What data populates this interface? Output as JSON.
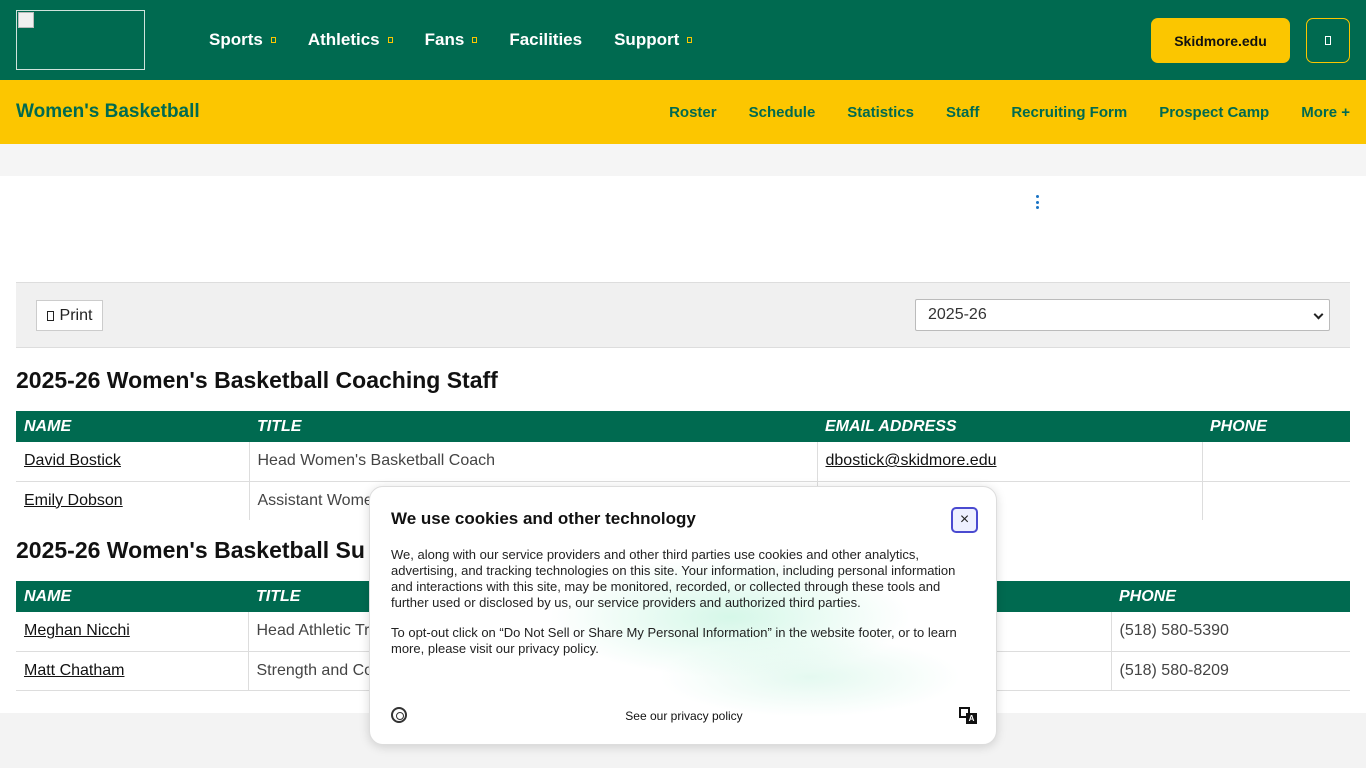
{
  "header": {
    "nav": [
      {
        "label": "Sports",
        "has_dropdown": true
      },
      {
        "label": "Athletics",
        "has_dropdown": true
      },
      {
        "label": "Fans",
        "has_dropdown": true
      },
      {
        "label": "Facilities",
        "has_dropdown": false
      },
      {
        "label": "Support",
        "has_dropdown": true
      }
    ],
    "site_button": "Skidmore.edu",
    "menu_icon": "menu-icon"
  },
  "subnav": {
    "sport": "Women's Basketball",
    "items": [
      "Roster",
      "Schedule",
      "Statistics",
      "Staff",
      "Recruiting Form",
      "Prospect Camp",
      "More +"
    ]
  },
  "toolbar": {
    "print_label": "Print",
    "season_selected": "2025-26"
  },
  "coaching": {
    "title": "2025-26 Women's Basketball Coaching Staff",
    "headers": [
      "NAME",
      "TITLE",
      "EMAIL ADDRESS",
      "PHONE"
    ],
    "rows": [
      {
        "name": "David Bostick",
        "title": "Head Women's Basketball Coach",
        "email": "dbostick@skidmore.edu",
        "phone": ""
      },
      {
        "name": "Emily Dobson",
        "title": "Assistant Wome",
        "email": "",
        "phone": ""
      }
    ]
  },
  "support": {
    "title": "2025-26 Women's Basketball Su",
    "headers": [
      "NAME",
      "TITLE",
      "",
      "PHONE"
    ],
    "rows": [
      {
        "name": "Meghan Nicchi",
        "title": "Head Athletic Tr",
        "phone": "(518) 580-5390"
      },
      {
        "name": "Matt Chatham",
        "title": "Strength and Co",
        "phone": "(518) 580-8209"
      }
    ]
  },
  "cookie": {
    "title": "We use cookies and other technology",
    "paragraph1": "We, along with our service providers and other third parties use cookies and other analytics, advertising, and tracking technologies on this site. Your information, including personal information and interactions with this site, may be monitored, recorded, or collected through these tools and further used or disclosed by us, our service providers and authorized third parties.",
    "paragraph2": "To opt-out click on “Do Not Sell or Share My Personal Information” in the website footer, or to learn more, please visit our privacy policy.",
    "privacy_link": "See our privacy policy",
    "close_glyph": "×"
  },
  "colors": {
    "brand_green": "#006a50",
    "brand_gold": "#fcc600"
  }
}
